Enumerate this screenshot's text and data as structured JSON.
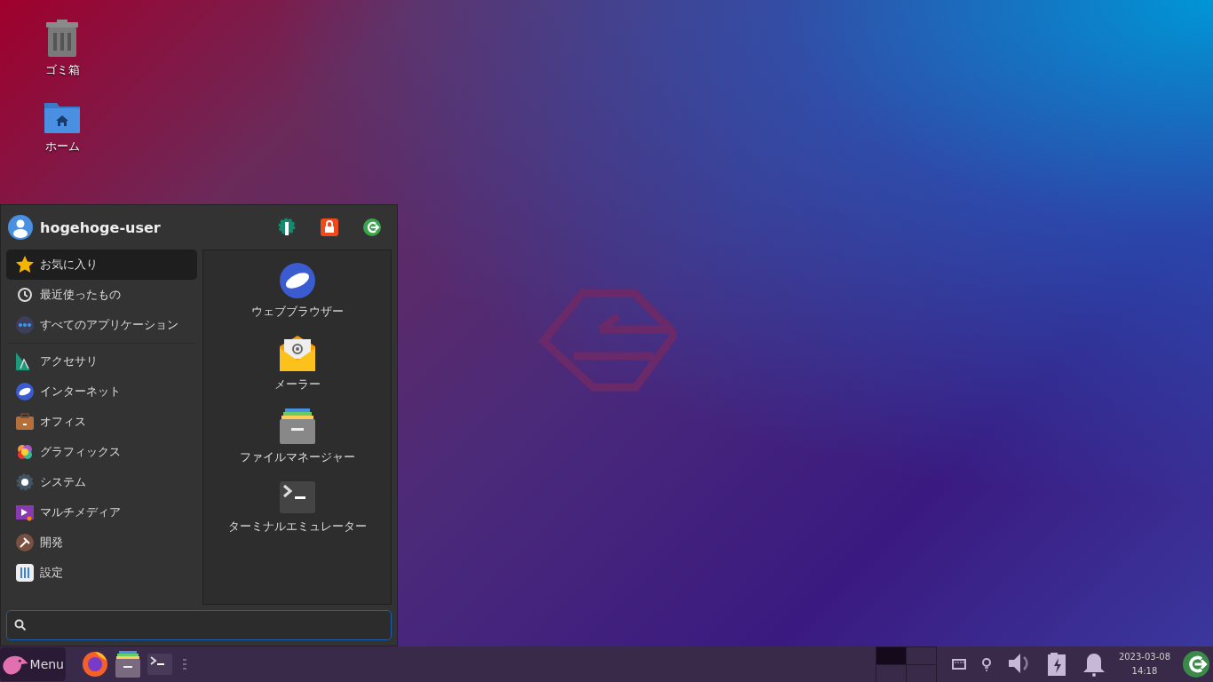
{
  "desktop_icons": [
    {
      "label": "ゴミ箱",
      "kind": "trash"
    },
    {
      "label": "ホーム",
      "kind": "home"
    }
  ],
  "menu": {
    "user": "hogehoge-user",
    "actions": [
      {
        "kind": "settings"
      },
      {
        "kind": "lock"
      },
      {
        "kind": "logout"
      }
    ],
    "places": [
      {
        "label": "お気に入り",
        "kind": "star",
        "selected": true
      },
      {
        "label": "最近使ったもの",
        "kind": "clock",
        "selected": false
      },
      {
        "label": "すべてのアプリケーション",
        "kind": "dots",
        "selected": false
      }
    ],
    "categories": [
      {
        "label": "アクセサリ",
        "kind": "accessories",
        "selected": false
      },
      {
        "label": "インターネット",
        "kind": "internet",
        "selected": false
      },
      {
        "label": "オフィス",
        "kind": "office",
        "selected": false
      },
      {
        "label": "グラフィックス",
        "kind": "graphics",
        "selected": false
      },
      {
        "label": "システム",
        "kind": "system",
        "selected": false
      },
      {
        "label": "マルチメディア",
        "kind": "multimedia",
        "selected": false
      },
      {
        "label": "開発",
        "kind": "development",
        "selected": false
      },
      {
        "label": "設定",
        "kind": "settings",
        "selected": false
      }
    ],
    "apps": [
      {
        "label": "ウェブブラウザー",
        "kind": "browser"
      },
      {
        "label": "メーラー",
        "kind": "mail"
      },
      {
        "label": "ファイルマネージャー",
        "kind": "files"
      },
      {
        "label": "ターミナルエミュレーター",
        "kind": "terminal"
      }
    ]
  },
  "taskbar": {
    "menu_label": "Menu",
    "launchers": [
      {
        "kind": "firefox"
      },
      {
        "kind": "files"
      },
      {
        "kind": "terminal"
      }
    ],
    "workspaces": [
      {
        "selected": true
      },
      {
        "selected": false
      },
      {
        "selected": false
      },
      {
        "selected": false
      }
    ],
    "tray": [
      {
        "kind": "network"
      },
      {
        "kind": "bulb"
      },
      {
        "kind": "volume"
      },
      {
        "kind": "battery"
      },
      {
        "kind": "bell"
      }
    ],
    "date": "2023-03-08",
    "time": "14:18"
  }
}
